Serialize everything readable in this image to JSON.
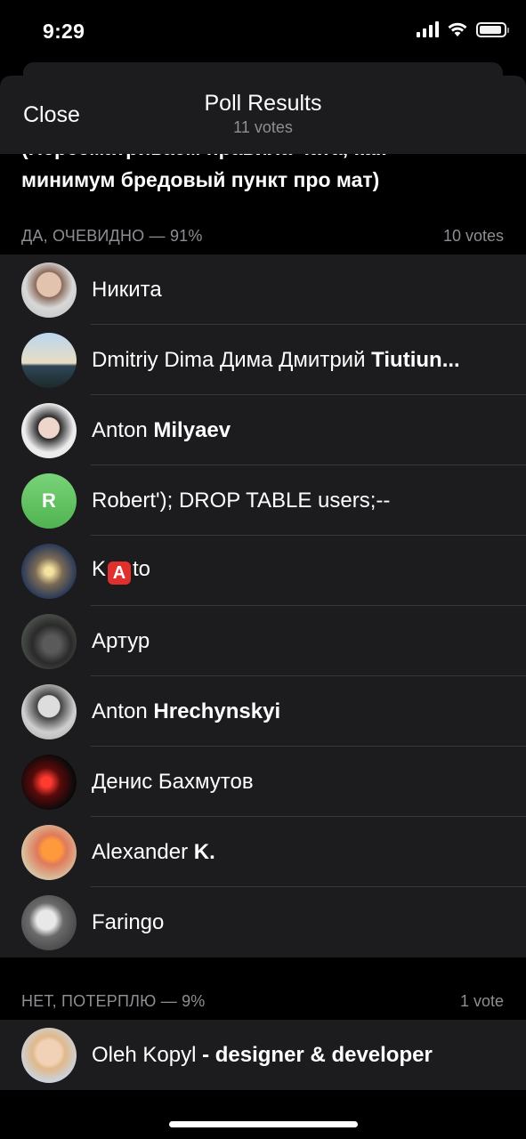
{
  "status_bar": {
    "time": "9:29"
  },
  "header": {
    "close_label": "Close",
    "title": "Poll Results",
    "subtitle": "11 votes"
  },
  "question": {
    "line1": "(Пересматриваем правила чата, как",
    "line2": "минимум бредовый пункт про мат)"
  },
  "options": [
    {
      "label": "ДА, ОЧЕВИДНО — 91%",
      "votes": "10 votes",
      "voters": [
        {
          "first": "Никита",
          "last": ""
        },
        {
          "first": "Dmitriy Dima Дима Дмитрий",
          "last": "Tiutiun..."
        },
        {
          "first": "Anton",
          "last": "Milyaev"
        },
        {
          "first": "Robert'); DROP TABLE users;--",
          "last": "",
          "initial": "R"
        },
        {
          "first": "K",
          "emoji": "A",
          "last": "to"
        },
        {
          "first": "Артур",
          "last": ""
        },
        {
          "first": "Anton",
          "last": "Hrechynskyi"
        },
        {
          "first": "Денис Бахмутов",
          "last": ""
        },
        {
          "first": "Alexander",
          "last": "K."
        },
        {
          "first": "Faringo",
          "last": ""
        }
      ]
    },
    {
      "label": "НЕТ, ПОТЕРПЛЮ — 9%",
      "votes": "1 vote",
      "voters": [
        {
          "first": "Oleh Kopyl",
          "last": "- designer & developer"
        }
      ]
    }
  ],
  "colors": {
    "background": "#000000",
    "cell": "#1c1c1e",
    "secondary_text": "#8e8e93",
    "separator": "#38383a"
  },
  "icons": [
    "signal-icon",
    "wifi-icon",
    "battery-icon"
  ]
}
